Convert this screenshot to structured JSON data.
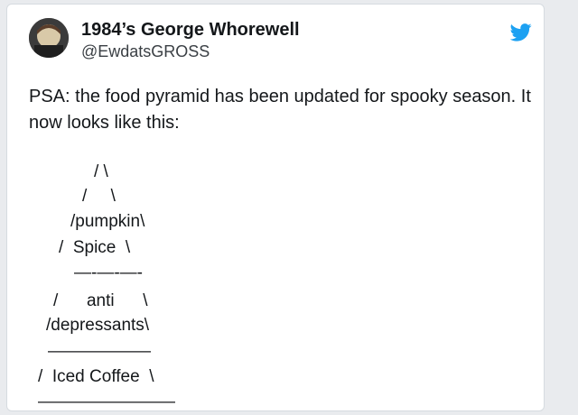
{
  "tweet": {
    "display_name": "1984’s George Whorewell",
    "handle": "@EwdatsGROSS",
    "text": "PSA: the food pyramid has been updated for spooky season. It now looks like this:",
    "platform_icon": "twitter-bird-icon",
    "accent_color": "#1da1f2",
    "pyramid": [
      "/ \\",
      "/     \\",
      "/pumpkin\\",
      "/  Spice  \\",
      "—-—-—-",
      "/      anti      \\",
      "/depressants\\",
      "——————",
      "/  Iced Coffee  \\",
      "————————"
    ]
  }
}
